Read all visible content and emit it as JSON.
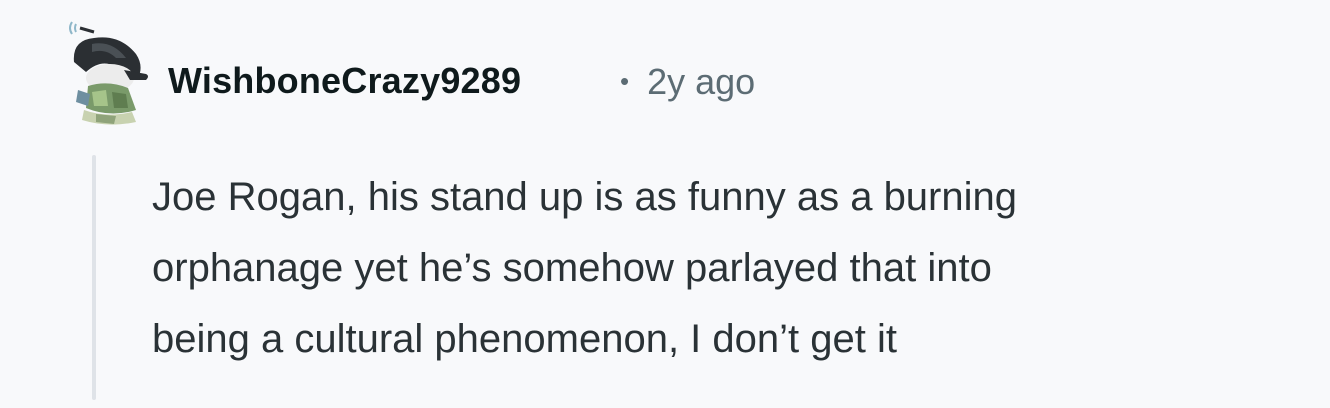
{
  "comment": {
    "author": "WishboneCrazy9289",
    "separator": "•",
    "age": "2y ago",
    "body_lines": [
      "Joe Rogan, his stand up is as funny as a burning",
      "orphanage yet he’s somehow parlayed that into",
      "being a cultural phenomenon, I don’t get it"
    ]
  },
  "avatar": {
    "icon": "snoo-avatar-icon"
  }
}
